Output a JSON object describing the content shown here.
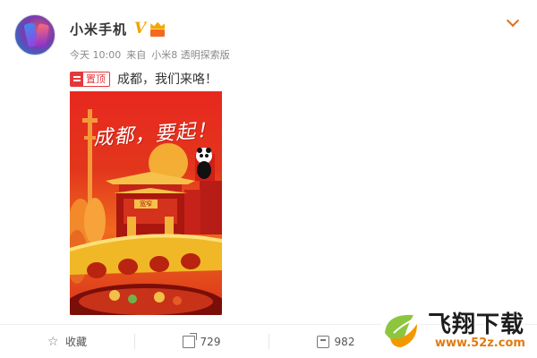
{
  "user": {
    "name": "小米手机",
    "verified_mark": "V",
    "time": "今天 10:00",
    "source_prefix": "来自",
    "source": "小米8 透明探索版"
  },
  "post": {
    "pinned_label": "置顶",
    "text": "成都，我们来咯！",
    "poster": {
      "slogan": "成都，要起！",
      "gate_sign": "宽窄",
      "colors": {
        "sky_top": "#e8281f",
        "sun": "#f7c23a",
        "bridge": "#f0b826"
      }
    }
  },
  "actions": {
    "favorite_label": "收藏",
    "repost_count": "729",
    "comment_count": "982",
    "like_count": ""
  },
  "watermark": {
    "title": "飞翔下载",
    "url": "www.52z.com"
  },
  "colors": {
    "accent": "#e06f1c",
    "pin_red": "#e4393c",
    "meta_gray": "#8a8a8a"
  }
}
